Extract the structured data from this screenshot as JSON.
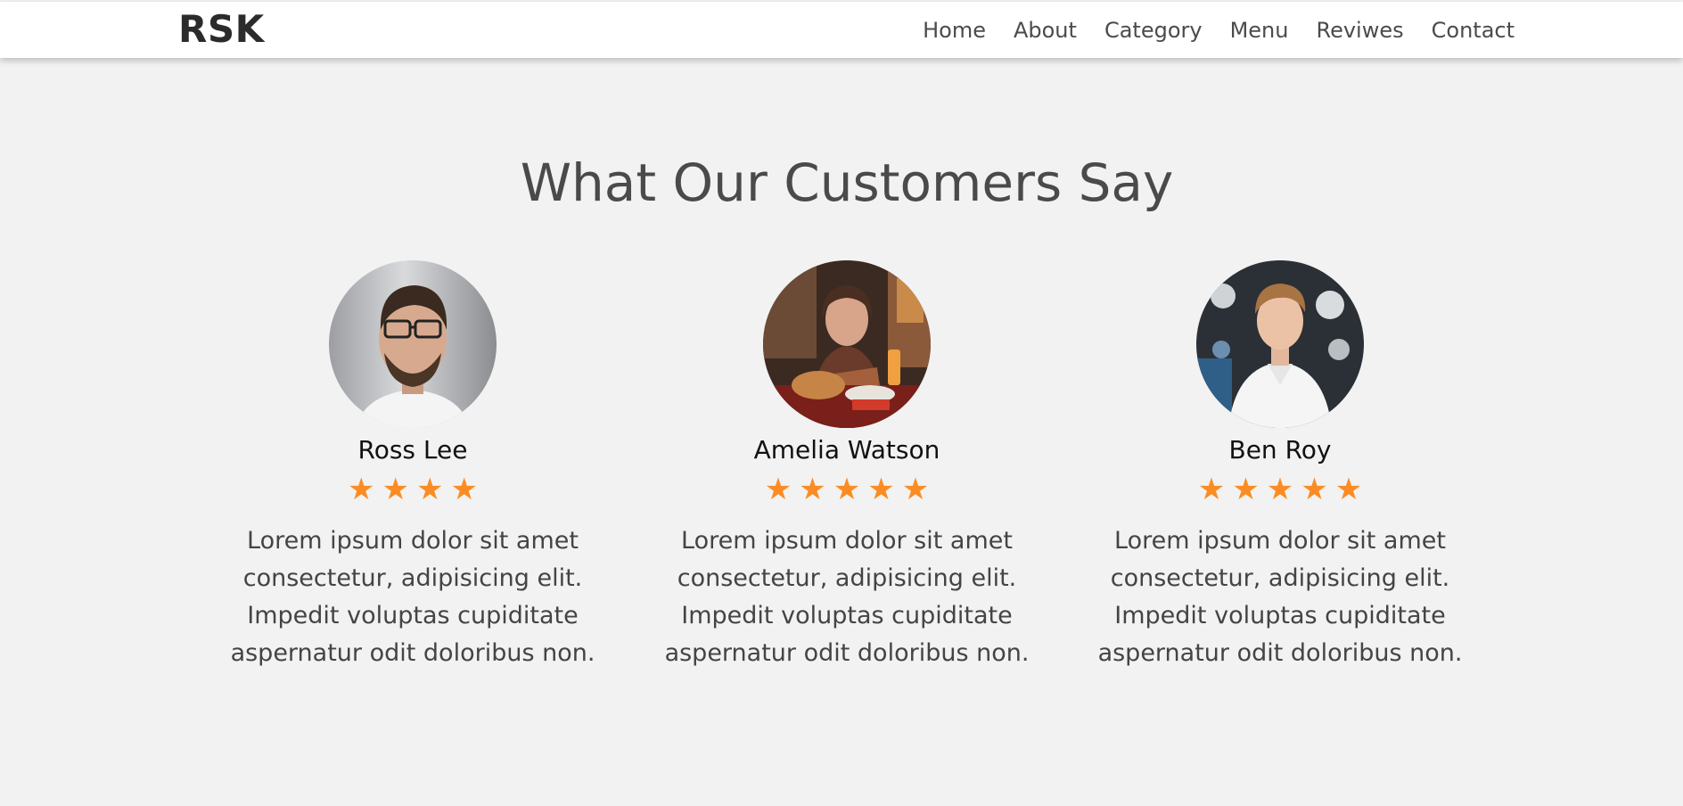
{
  "brand": {
    "logo": "RSK"
  },
  "nav": {
    "items": [
      {
        "label": "Home"
      },
      {
        "label": "About"
      },
      {
        "label": "Category"
      },
      {
        "label": "Menu"
      },
      {
        "label": "Reviwes"
      },
      {
        "label": "Contact"
      }
    ]
  },
  "section": {
    "title": "What Our Customers Say"
  },
  "colors": {
    "page_bg": "#f2f2f2",
    "star": "#fb8c24",
    "title": "#4a4a4a"
  },
  "reviews": [
    {
      "name": "Ross Lee",
      "rating": 4,
      "avatar_icon": "man-glasses-photo",
      "text": "Lorem ipsum dolor sit amet consectetur, adipisicing elit. Impedit voluptas cupiditate aspernatur odit doloribus non."
    },
    {
      "name": "Amelia Watson",
      "rating": 5,
      "avatar_icon": "woman-restaurant-photo",
      "text": "Lorem ipsum dolor sit amet consectetur, adipisicing elit. Impedit voluptas cupiditate aspernatur odit doloribus non."
    },
    {
      "name": "Ben Roy",
      "rating": 5,
      "avatar_icon": "young-man-shirt-photo",
      "text": "Lorem ipsum dolor sit amet consectetur, adipisicing elit. Impedit voluptas cupiditate aspernatur odit doloribus non."
    }
  ]
}
